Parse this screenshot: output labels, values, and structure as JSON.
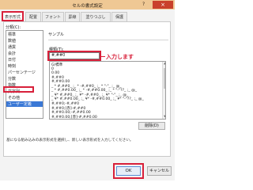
{
  "window": {
    "left_label": "",
    "title": "セルの書式設定",
    "help_glyph": "?",
    "close_glyph": "×"
  },
  "tabs": [
    {
      "label": "表示形式",
      "active": true
    },
    {
      "label": "配置"
    },
    {
      "label": "フォント"
    },
    {
      "label": "罫線"
    },
    {
      "label": "塗りつぶし"
    },
    {
      "label": "保護"
    }
  ],
  "category": {
    "label": "分類(C):",
    "items": [
      "標準",
      "数値",
      "通貨",
      "会計",
      "日付",
      "時刻",
      "パーセンテージ",
      "分数",
      "指数",
      "文字列",
      "その他",
      "ユーザー定義"
    ],
    "selected": "ユーザー定義"
  },
  "sample": {
    "label": "サンプル"
  },
  "type": {
    "label": "種類(T):",
    "value": "#,##0",
    "callout": "入力します"
  },
  "formats": [
    "G/標準",
    "0",
    "0.00",
    "#,##0",
    "#,##0.00",
    "_ * #,##0_ ;_ * -#,##0_ ;_ * \"-\"_ ;_ @_",
    "_ * #,##0.00_ ;_ * -#,##0.00_ ;_ * \"-\"??_ ;_ @_",
    "_ ¥* #,##0_ ;_ ¥* -#,##0_ ;_ ¥* \"-\"_ ;_ @_",
    "_ ¥* #,##0.00_ ;_ ¥* -#,##0.00_ ;_ ¥* \"-\"??_ ;_ @_",
    "#,##0;-#,##0",
    "#,##0;[赤]-#,##0",
    "#,##0.00;-#,##0.00",
    "#,##0.00;[赤]-#,##0.00"
  ],
  "buttons": {
    "delete": "削除(D)",
    "ok": "OK",
    "cancel": "キャンセル"
  },
  "description": "基になる組み込みの表示形式を選択し、新しい表示形式を入力してください。",
  "colors": {
    "titlebar": "#efc894",
    "close": "#c9402c",
    "highlight": "#d8203a",
    "selection": "#3a78d6"
  }
}
